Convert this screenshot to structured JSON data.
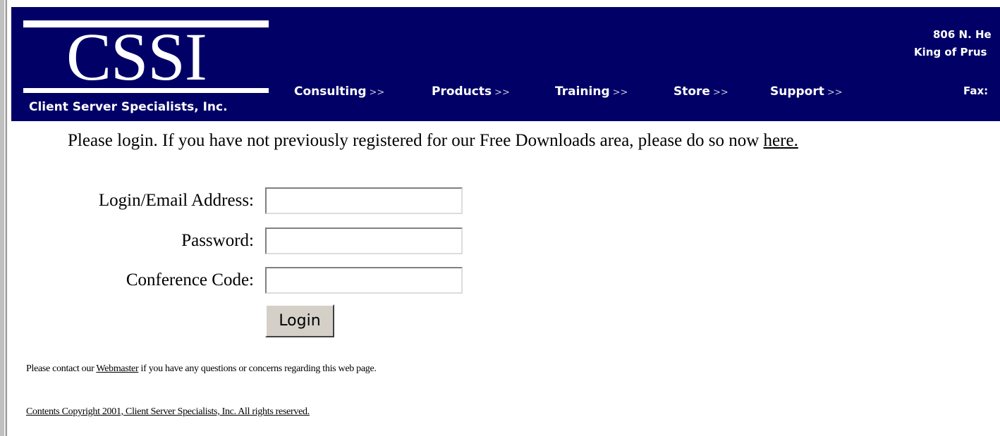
{
  "header": {
    "logo_text": "CSSI",
    "logo_subtitle": "Client Server Specialists, Inc.",
    "nav": [
      {
        "label": "Consulting",
        "arrow": ">>"
      },
      {
        "label": "Products",
        "arrow": ">>"
      },
      {
        "label": "Training",
        "arrow": ">>"
      },
      {
        "label": "Store",
        "arrow": ">>"
      },
      {
        "label": "Support",
        "arrow": ">>"
      }
    ],
    "address_line1": "806 N. He",
    "address_line2": "King of Prus",
    "fax_label": "Fax:",
    "background_color": "#000066"
  },
  "main": {
    "intro_text": "Please login. If you have not previously registered for our Free Downloads area, please do so now ",
    "intro_link": "here.",
    "form": {
      "login_label": "Login/Email Address:",
      "login_value": "",
      "password_label": "Password:",
      "password_value": "",
      "conference_label": "Conference Code:",
      "conference_value": "",
      "submit_label": "Login"
    },
    "contact_prefix": "Please contact our ",
    "contact_link": "Webmaster",
    "contact_suffix": " if you have any questions or concerns regarding this web page.",
    "copyright": "Contents Copyright 2001, Client Server Specialists, Inc. All rights reserved."
  }
}
